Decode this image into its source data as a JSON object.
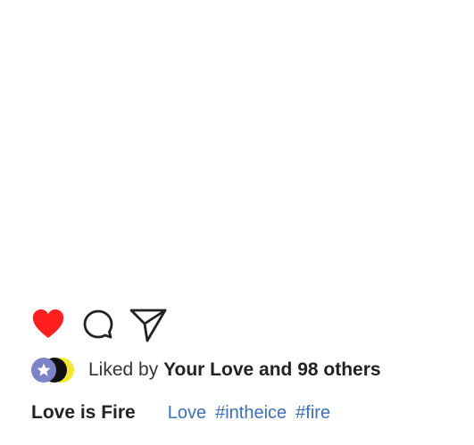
{
  "post": {
    "actions": {
      "like_icon": "heart-icon",
      "comment_icon": "comment-bubble-icon",
      "share_icon": "paper-plane-icon",
      "like_color": "#ff1f1f",
      "outline_color": "#222222"
    },
    "likes": {
      "prefix": "Liked by",
      "summary": "Your Love and 98 others",
      "avatar_colors": [
        "#7c83c6",
        "#111111",
        "#f2e637"
      ],
      "first_avatar_icon": "star-icon"
    },
    "caption": {
      "title": "Love is Fire",
      "tags": [
        "Love",
        "#intheice",
        "#fire"
      ],
      "tag_color": "#3d6fb4"
    }
  }
}
